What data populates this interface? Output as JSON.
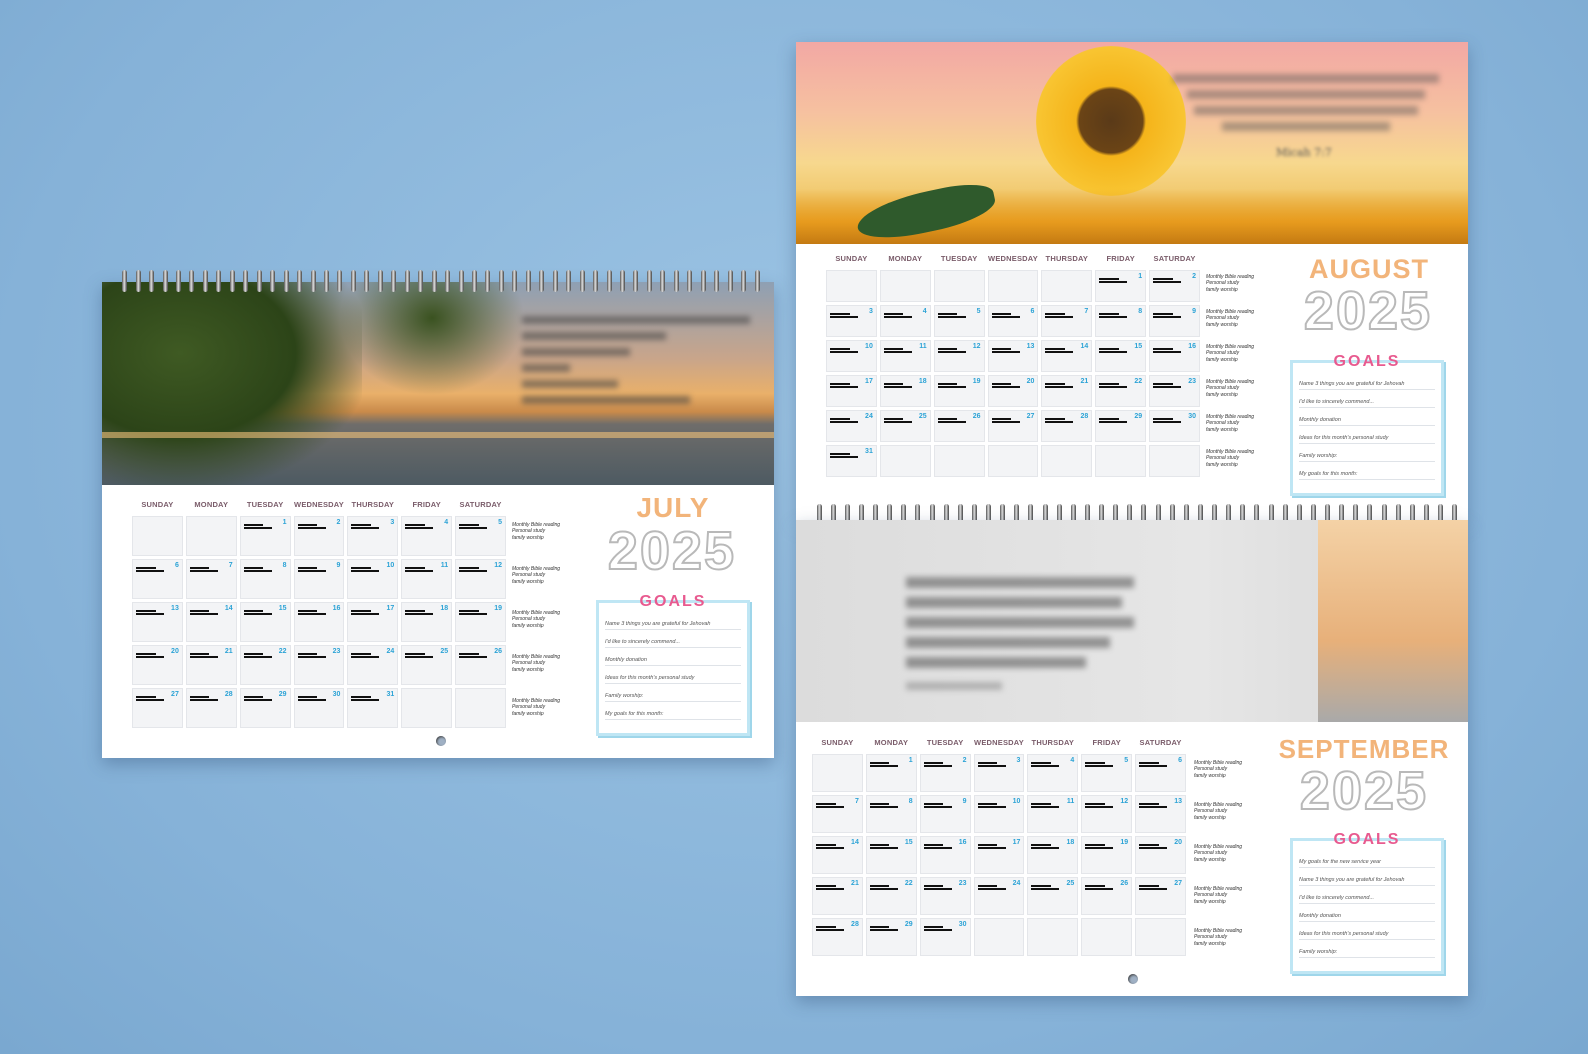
{
  "day_names": [
    "SUNDAY",
    "MONDAY",
    "TUESDAY",
    "WEDNESDAY",
    "THURSDAY",
    "FRIDAY",
    "SATURDAY"
  ],
  "week_side": [
    "Monthly Bible reading",
    "Personal study",
    "family worship"
  ],
  "july": {
    "month": "JULY",
    "year": "2025",
    "goals_title": "GOALS",
    "goal_lines": [
      "Name 3 things you are grateful for Jehovah",
      "I'd like to sincerely commend...",
      "Monthly donation",
      "Ideas for this month's personal study",
      "Family worship:",
      "My goals for this month:"
    ]
  },
  "august": {
    "month": "AUGUST",
    "year": "2025",
    "goals_title": "GOALS",
    "quote_ref": "Micah 7:7",
    "goal_lines": [
      "Name 3 things you are grateful for Jehovah",
      "I'd like to sincerely commend...",
      "Monthly donation",
      "Ideas for this month's personal study",
      "Family worship:",
      "My goals for this month:"
    ]
  },
  "september": {
    "month": "SEPTEMBER",
    "year": "2025",
    "goals_title": "GOALS",
    "goal_lines": [
      "My goals for the new service year",
      "Name 3 things you are grateful for Jehovah",
      "I'd like to sincerely commend...",
      "Monthly donation",
      "Ideas for this month's personal study",
      "Family worship:"
    ]
  }
}
